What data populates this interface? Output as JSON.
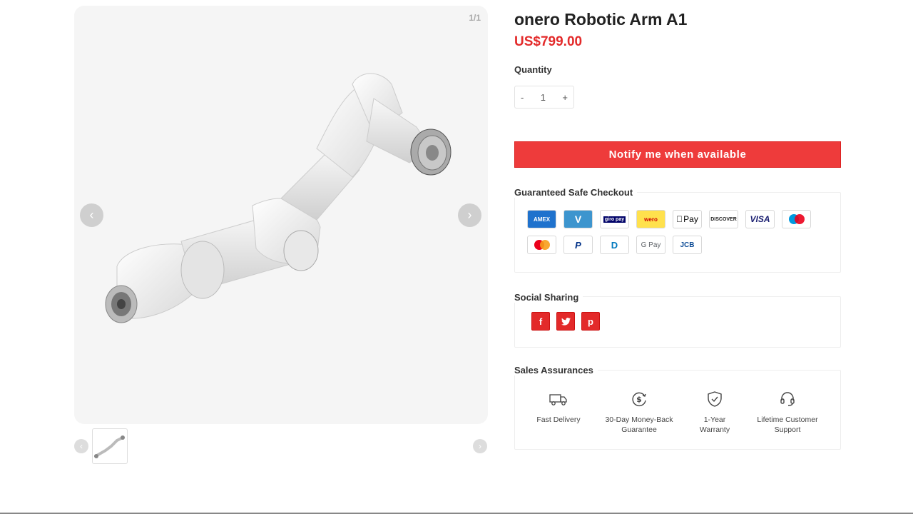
{
  "gallery": {
    "counter": "1/1",
    "prev_arrow": "‹",
    "next_arrow": "›",
    "image_alt": "robotic-arm-photo"
  },
  "thumbnails": {
    "prev_arrow": "‹",
    "next_arrow": "›"
  },
  "product": {
    "title": "onero Robotic Arm A1",
    "price": "US$799.00",
    "quantity_label": "Quantity",
    "quantity_minus": "-",
    "quantity_value": "1",
    "quantity_plus": "+",
    "notify_button": "Notify me when available"
  },
  "checkout": {
    "label": "Guaranteed Safe Checkout",
    "methods": [
      {
        "name": "American Express",
        "icon": "amex-icon",
        "text": "AMEX",
        "color": "#1f72cd"
      },
      {
        "name": "Venmo",
        "icon": "venmo-icon",
        "text": "V",
        "color": "#3d95ce"
      },
      {
        "name": "Giropay",
        "icon": "giropay-icon",
        "text": "giro pay",
        "color": "#000268"
      },
      {
        "name": "iDEAL wero",
        "icon": "wero-icon",
        "text": "wero",
        "color": "#ffe14d"
      },
      {
        "name": "Apple Pay",
        "icon": "apple-pay-icon",
        "text": "Pay",
        "color": "#000000"
      },
      {
        "name": "Discover",
        "icon": "discover-icon",
        "text": "DISCOVER",
        "color": "#f48120"
      },
      {
        "name": "Visa",
        "icon": "visa-icon",
        "text": "VISA",
        "color": "#1a1f71"
      },
      {
        "name": "Maestro",
        "icon": "maestro-icon",
        "text": "",
        "color": "#eb001b"
      },
      {
        "name": "Mastercard",
        "icon": "mastercard-icon",
        "text": "",
        "color": "#eb001b"
      },
      {
        "name": "PayPal",
        "icon": "paypal-icon",
        "text": "P",
        "color": "#003087"
      },
      {
        "name": "Diners Club",
        "icon": "diners-icon",
        "text": "D",
        "color": "#0079be"
      },
      {
        "name": "Google Pay",
        "icon": "google-pay-icon",
        "text": "G Pay",
        "color": "#5f6368"
      },
      {
        "name": "JCB",
        "icon": "jcb-icon",
        "text": "JCB",
        "color": "#0e4c96"
      }
    ]
  },
  "sharing": {
    "label": "Social Sharing",
    "items": [
      {
        "name": "facebook",
        "glyph": "f"
      },
      {
        "name": "twitter",
        "glyph": "t"
      },
      {
        "name": "pinterest",
        "glyph": "p"
      }
    ]
  },
  "assurances": {
    "label": "Sales Assurances",
    "fast_delivery": "Fast Delivery",
    "money_back_1": "30-Day Money-Back",
    "money_back_2": "Guarantee",
    "warranty_1": "1-Year",
    "warranty_2": "Warranty",
    "support_1": "Lifetime Customer",
    "support_2": "Support"
  },
  "colors": {
    "accent": "#e32a2a",
    "button": "#ee3b3b"
  }
}
